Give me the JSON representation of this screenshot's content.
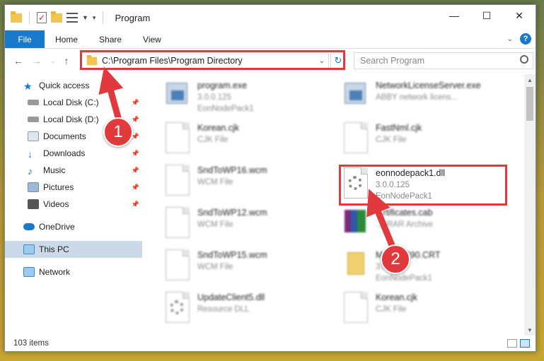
{
  "window": {
    "title": "Program",
    "controls": [
      "minimize-icon",
      "maximize-icon",
      "close-icon"
    ]
  },
  "ribbon": {
    "tabs": [
      "File",
      "Home",
      "Share",
      "View"
    ]
  },
  "address": {
    "path": "C:\\Program Files\\Program Directory",
    "search_placeholder": "Search Program"
  },
  "sidebar": {
    "items": [
      {
        "label": "Quick access",
        "icon": "star-icon",
        "color": "#1979ca"
      },
      {
        "label": "Local Disk (C:)",
        "icon": "drive-icon",
        "color": "#777777",
        "pinned": true
      },
      {
        "label": "Local Disk (D:)",
        "icon": "drive-icon",
        "color": "#777777",
        "pinned": true
      },
      {
        "label": "Documents",
        "icon": "documents-icon",
        "color": "#8a9bb0",
        "pinned": true
      },
      {
        "label": "Downloads",
        "icon": "download-icon",
        "color": "#1979ca",
        "pinned": true
      },
      {
        "label": "Music",
        "icon": "music-icon",
        "color": "#1979ca",
        "pinned": true
      },
      {
        "label": "Pictures",
        "icon": "pictures-icon",
        "color": "#6a8fb8",
        "pinned": true
      },
      {
        "label": "Videos",
        "icon": "videos-icon",
        "color": "#555555",
        "pinned": true
      },
      {
        "label": "OneDrive",
        "icon": "cloud-icon",
        "color": "#1979ca"
      },
      {
        "label": "This PC",
        "icon": "computer-icon",
        "color": "#3a88c9",
        "selected": true
      },
      {
        "label": "Network",
        "icon": "network-icon",
        "color": "#3a88c9"
      }
    ]
  },
  "files": [
    {
      "name": "program.exe",
      "line2": "3.0.0.125",
      "line3": "EonNodePack1",
      "kind": "exe"
    },
    {
      "name": "NetworkLicenseServer.exe",
      "line2": "ABBY network licens...",
      "line3": "",
      "kind": "exe"
    },
    {
      "name": "Korean.cjk",
      "line2": "CJK File",
      "line3": "",
      "kind": "doc"
    },
    {
      "name": "FastNml.cjk",
      "line2": "CJK File",
      "line3": "",
      "kind": "doc"
    },
    {
      "name": "SndToWP16.wcm",
      "line2": "WCM File",
      "line3": "",
      "kind": "doc"
    },
    {
      "name": "eonnodepack1.dll",
      "line2": "3.0.0.125",
      "line3": "EonNodePack1",
      "kind": "dll"
    },
    {
      "name": "SndToWP12.wcm",
      "line2": "WCM File",
      "line3": "",
      "kind": "doc"
    },
    {
      "name": "...rtificates.cab",
      "line2": "...nRAR Archive",
      "line3": "",
      "kind": "rar"
    },
    {
      "name": "SndToWP15.wcm",
      "line2": "WCM File",
      "line3": "",
      "kind": "doc"
    },
    {
      "name": "M...ft.VC90.CRT",
      "line2": "3.0...",
      "line3": "EonNodePack1",
      "kind": "zip"
    },
    {
      "name": "UpdateClient5.dll",
      "line2": "Resource DLL",
      "line3": "",
      "kind": "dll"
    },
    {
      "name": "Korean.cjk",
      "line2": "CJK File",
      "line3": "",
      "kind": "doc"
    }
  ],
  "annotations": {
    "badge1": "1",
    "badge2": "2",
    "highlight_color": "#e0393e"
  },
  "status": {
    "count": "103 items"
  }
}
